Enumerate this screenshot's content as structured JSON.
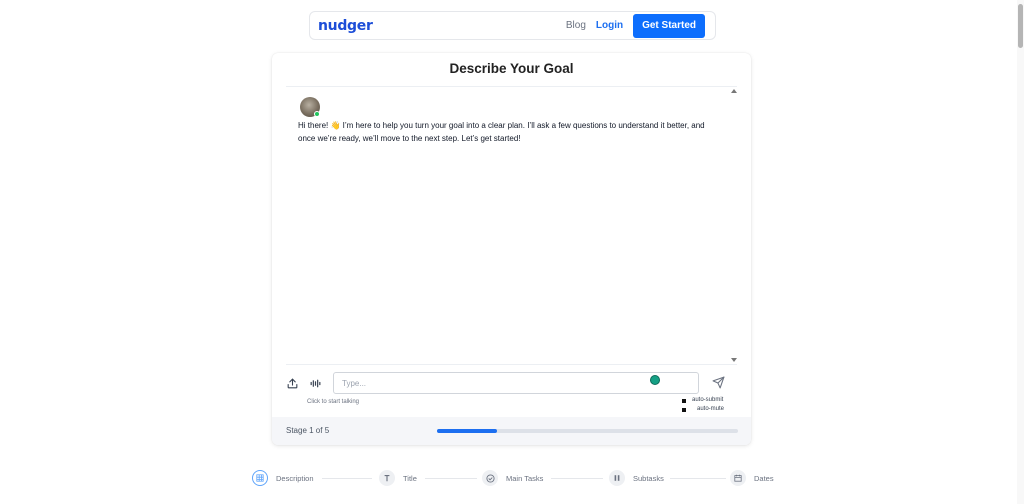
{
  "nav": {
    "logo": "nudger",
    "blog": "Blog",
    "login": "Login",
    "cta": "Get Started"
  },
  "card": {
    "title": "Describe Your Goal",
    "message": "Hi there! 👋 I’m here to help you turn your goal into a clear plan. I’ll ask a few questions to understand it better, and once we’re ready, we’ll move to the next step. Let’s get started!"
  },
  "composer": {
    "placeholder": "Type...",
    "hint": "Click to start talking",
    "options": [
      "auto-submit",
      "auto-mute"
    ]
  },
  "progress": {
    "stage_text": "Stage 1 of 5",
    "fraction": 0.2
  },
  "stepper": {
    "steps": [
      {
        "label": "Description",
        "icon": "grid-icon"
      },
      {
        "label": "Title",
        "icon": "text-t-icon"
      },
      {
        "label": "Main Tasks",
        "icon": "check-circle-icon"
      },
      {
        "label": "Subtasks",
        "icon": "columns-icon"
      },
      {
        "label": "Dates",
        "icon": "calendar-icon"
      }
    ]
  },
  "colors": {
    "accent": "#0d6efd",
    "brand": "#1d4ed8",
    "progress": "#1d6ff0"
  }
}
